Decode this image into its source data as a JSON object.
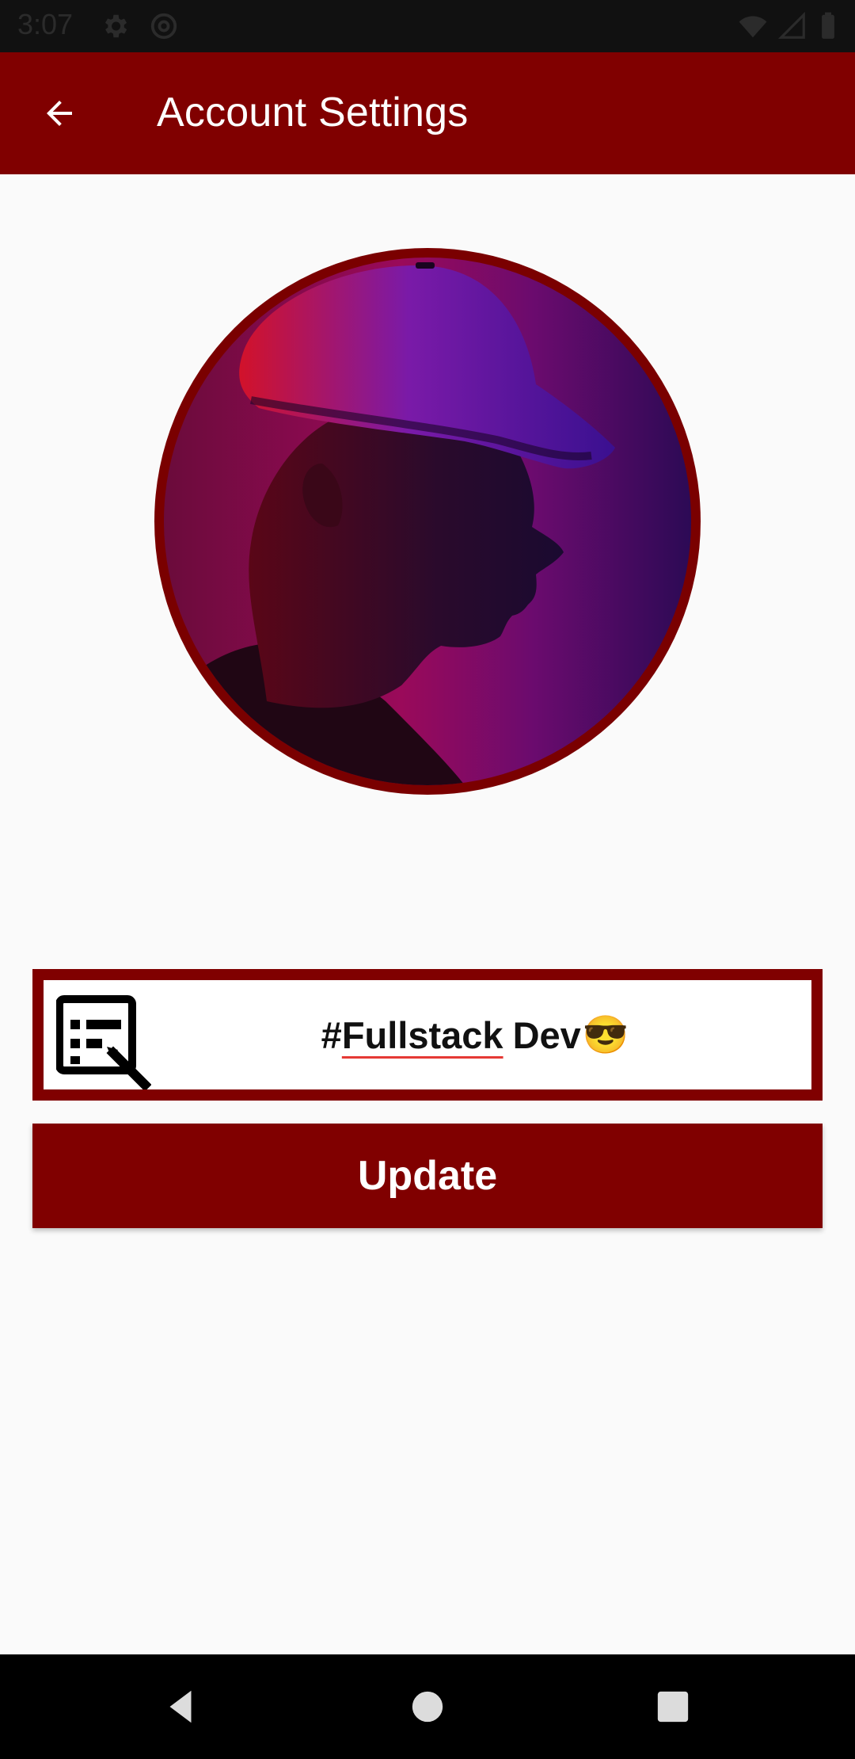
{
  "status_bar": {
    "time": "3:07",
    "icons": [
      "settings-icon",
      "at-sign-icon",
      "wifi-icon",
      "cell-signal-icon",
      "battery-icon"
    ]
  },
  "app_bar": {
    "title": "Account Settings",
    "back_icon": "arrow-left-icon"
  },
  "profile": {
    "avatar_icon": "profile-photo"
  },
  "status": {
    "hash": "#",
    "word": "Fullstack",
    "suffix": "Dev",
    "emoji": "😎",
    "edit_icon": "edit-note-icon"
  },
  "actions": {
    "update_label": "Update"
  },
  "nav_bar": {
    "icons": [
      "back-triangle-icon",
      "home-circle-icon",
      "recents-square-icon"
    ]
  },
  "colors": {
    "primary": "#800000",
    "background": "#FAFAFA",
    "status_bar": "#111111",
    "nav_bar": "#000000"
  }
}
